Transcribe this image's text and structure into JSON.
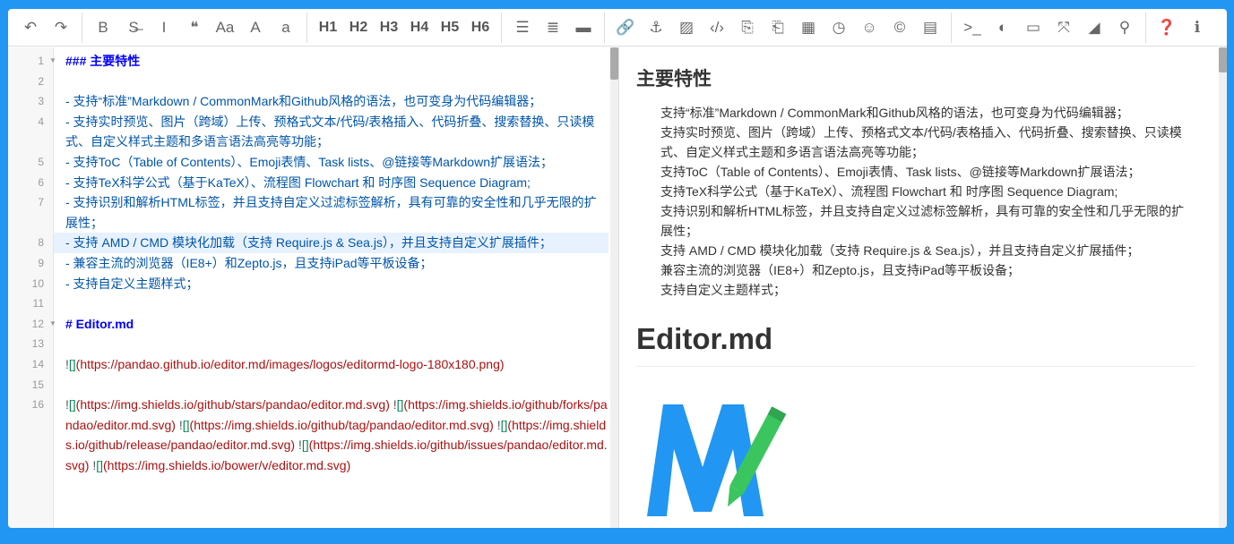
{
  "toolbar": {
    "groups": [
      [
        {
          "name": "undo-icon",
          "g": "↶"
        },
        {
          "name": "redo-icon",
          "g": "↷"
        }
      ],
      [
        {
          "name": "bold-icon",
          "g": "B"
        },
        {
          "name": "strikethrough-icon",
          "g": "S̶"
        },
        {
          "name": "italic-icon",
          "g": "I"
        },
        {
          "name": "quote-icon",
          "g": "❝"
        },
        {
          "name": "uppercase-icon",
          "g": "Aa"
        },
        {
          "name": "title-case-icon",
          "g": "A"
        },
        {
          "name": "lowercase-icon",
          "g": "a"
        }
      ],
      [
        {
          "name": "h1-button",
          "t": "H1"
        },
        {
          "name": "h2-button",
          "t": "H2"
        },
        {
          "name": "h3-button",
          "t": "H3"
        },
        {
          "name": "h4-button",
          "t": "H4"
        },
        {
          "name": "h5-button",
          "t": "H5"
        },
        {
          "name": "h6-button",
          "t": "H6"
        }
      ],
      [
        {
          "name": "unordered-list-icon",
          "g": "☰"
        },
        {
          "name": "ordered-list-icon",
          "g": "≣"
        },
        {
          "name": "horizontal-rule-icon",
          "g": "▬"
        }
      ],
      [
        {
          "name": "link-icon",
          "g": "🔗"
        },
        {
          "name": "anchor-icon",
          "g": "⚓"
        },
        {
          "name": "image-icon",
          "g": "▨"
        },
        {
          "name": "code-icon",
          "g": "‹/›"
        },
        {
          "name": "preformatted-code-icon",
          "g": "⎘"
        },
        {
          "name": "code-block-icon",
          "g": "⎗"
        },
        {
          "name": "table-icon",
          "g": "▦"
        },
        {
          "name": "datetime-icon",
          "g": "◷"
        },
        {
          "name": "emoji-icon",
          "g": "☺"
        },
        {
          "name": "html-entities-icon",
          "g": "©"
        },
        {
          "name": "pagebreak-icon",
          "g": "▤"
        }
      ],
      [
        {
          "name": "goto-line-icon",
          "g": ">_"
        },
        {
          "name": "unwatch-icon",
          "g": "◐"
        },
        {
          "name": "preview-icon",
          "g": "▭"
        },
        {
          "name": "fullscreen-icon",
          "g": "⤧"
        },
        {
          "name": "clear-icon",
          "g": "◢"
        },
        {
          "name": "search-icon",
          "g": "⚲"
        }
      ],
      [
        {
          "name": "help-icon",
          "g": "❓"
        },
        {
          "name": "info-icon",
          "g": "ℹ"
        }
      ]
    ]
  },
  "editor": {
    "lines": [
      {
        "n": "1",
        "fold": true,
        "parts": [
          {
            "c": "hd",
            "t": "### 主要特性"
          }
        ]
      },
      {
        "n": "2",
        "parts": []
      },
      {
        "n": "3",
        "parts": [
          {
            "c": "li",
            "t": "- 支持“标准”Markdown / CommonMark和Github风格的语法，也可变身为代码编辑器；"
          }
        ]
      },
      {
        "n": "4",
        "parts": [
          {
            "c": "li",
            "t": "- 支持实时预览、图片（跨域）上传、预格式文本/代码/表格插入、代码折叠、搜索替换、只读模式、自定义样式主题和多语言语法高亮等功能；"
          }
        ]
      },
      {
        "n": "5",
        "parts": [
          {
            "c": "li",
            "t": "- 支持ToC（Table of Contents）、Emoji表情、Task lists、@链接等Markdown扩展语法；"
          }
        ]
      },
      {
        "n": "6",
        "parts": [
          {
            "c": "li",
            "t": "- 支持TeX科学公式（基于KaTeX）、流程图 Flowchart 和 时序图 Sequence Diagram;"
          }
        ]
      },
      {
        "n": "7",
        "parts": [
          {
            "c": "li",
            "t": "- 支持识别和解析HTML标签，并且支持自定义过滤标签解析，具有可靠的安全性和几乎无限的扩展性；"
          }
        ]
      },
      {
        "n": "8",
        "active": true,
        "parts": [
          {
            "c": "li",
            "t": "- 支持 AMD / CMD 模块化加载（支持 Require.js & Sea.js），并且支持自定义扩展插件；"
          }
        ]
      },
      {
        "n": "9",
        "parts": [
          {
            "c": "li",
            "t": "- 兼容主流的浏览器（IE8+）和Zepto.js，且支持iPad等平板设备；"
          }
        ]
      },
      {
        "n": "10",
        "parts": [
          {
            "c": "li",
            "t": "- 支持自定义主题样式；"
          }
        ]
      },
      {
        "n": "11",
        "parts": []
      },
      {
        "n": "12",
        "fold": true,
        "parts": [
          {
            "c": "hd",
            "t": "# Editor.md"
          }
        ]
      },
      {
        "n": "13",
        "parts": []
      },
      {
        "n": "14",
        "parts": [
          {
            "c": "bang",
            "t": "!"
          },
          {
            "c": "br",
            "t": "[]"
          },
          {
            "c": "url",
            "t": "(https://pandao.github.io/editor.md/images/logos/editormd-logo-180x180.png)"
          }
        ]
      },
      {
        "n": "15",
        "parts": []
      },
      {
        "n": "16",
        "parts": [
          {
            "c": "bang",
            "t": "!"
          },
          {
            "c": "br",
            "t": "[]"
          },
          {
            "c": "url",
            "t": "(https://img.shields.io/github/stars/pandao/editor.md.svg) "
          },
          {
            "c": "bang",
            "t": "!"
          },
          {
            "c": "br",
            "t": "[]"
          },
          {
            "c": "url",
            "t": "(https://img.shields.io/github/forks/pandao/editor.md.svg) "
          },
          {
            "c": "bang",
            "t": "!"
          },
          {
            "c": "br",
            "t": "[]"
          },
          {
            "c": "url",
            "t": "(https://img.shields.io/github/tag/pandao/editor.md.svg) "
          },
          {
            "c": "bang",
            "t": "!"
          },
          {
            "c": "br",
            "t": "[]"
          },
          {
            "c": "url",
            "t": "(https://img.shields.io/github/release/pandao/editor.md.svg) "
          },
          {
            "c": "bang",
            "t": "!"
          },
          {
            "c": "br",
            "t": "[]"
          },
          {
            "c": "url",
            "t": "(https://img.shields.io/github/issues/pandao/editor.md.svg) "
          },
          {
            "c": "bang",
            "t": "!"
          },
          {
            "c": "br",
            "t": "[]"
          },
          {
            "c": "url",
            "t": "(https://img.shields.io/bower/v/editor.md.svg)"
          }
        ]
      }
    ]
  },
  "preview": {
    "h3": "主要特性",
    "items": [
      "支持“标准”Markdown / CommonMark和Github风格的语法，也可变身为代码编辑器；",
      "支持实时预览、图片（跨域）上传、预格式文本/代码/表格插入、代码折叠、搜索替换、只读模式、自定义样式主题和多语言语法高亮等功能；",
      "支持ToC（Table of Contents）、Emoji表情、Task lists、@链接等Markdown扩展语法；",
      "支持TeX科学公式（基于KaTeX）、流程图 Flowchart 和 时序图 Sequence Diagram;",
      "支持识别和解析HTML标签，并且支持自定义过滤标签解析，具有可靠的安全性和几乎无限的扩展性；",
      "支持 AMD / CMD 模块化加载（支持 Require.js & Sea.js），并且支持自定义扩展插件；",
      "兼容主流的浏览器（IE8+）和Zepto.js，且支持iPad等平板设备；",
      "支持自定义主题样式；"
    ],
    "h1": "Editor.md"
  },
  "colors": {
    "brand": "#2196f3",
    "logo_blue": "#2196f3",
    "logo_green": "#3ac55e"
  }
}
